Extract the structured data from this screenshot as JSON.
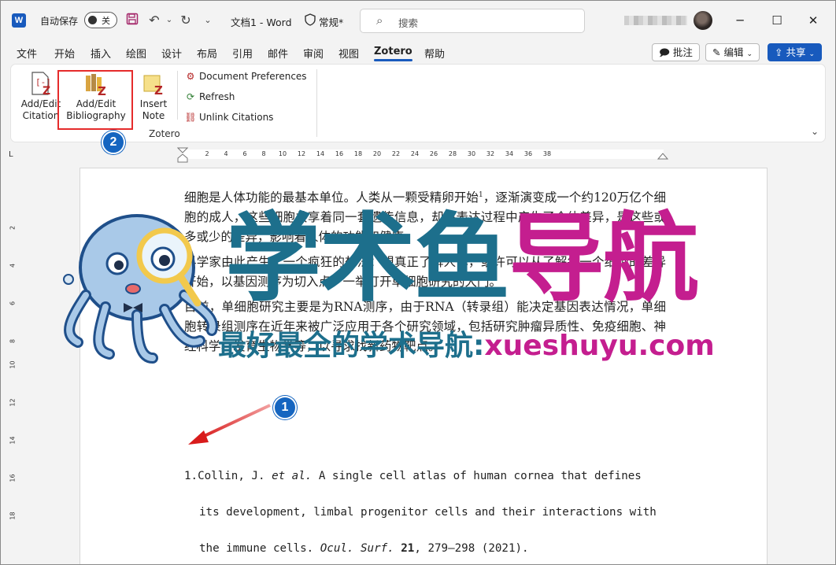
{
  "titlebar": {
    "autosave_label": "自动保存",
    "autosave_state": "关",
    "doc_title": "文档1 - Word",
    "sensitivity": "常规*",
    "search_placeholder": "搜索"
  },
  "menu": {
    "tabs": [
      "文件",
      "开始",
      "插入",
      "绘图",
      "设计",
      "布局",
      "引用",
      "邮件",
      "审阅",
      "视图",
      "Zotero",
      "帮助"
    ],
    "active_tab": "Zotero",
    "comment_label": "批注",
    "edit_label": "编辑",
    "share_label": "共享"
  },
  "ribbon": {
    "add_edit_citation": [
      "Add/Edit",
      "Citation"
    ],
    "add_edit_bibliography": [
      "Add/Edit",
      "Bibliography"
    ],
    "insert_note": [
      "Insert",
      "Note"
    ],
    "doc_prefs": "Document Preferences",
    "refresh": "Refresh",
    "unlink": "Unlink Citations",
    "group_label": "Zotero"
  },
  "annotations": {
    "badge_1": "1",
    "badge_2": "2"
  },
  "ruler": {
    "h_ticks": [
      "2",
      "4",
      "6",
      "8",
      "10",
      "12",
      "14",
      "16",
      "18",
      "20",
      "22",
      "24",
      "26",
      "28",
      "30",
      "32",
      "34",
      "36",
      "38"
    ],
    "v_ticks": [
      "2",
      "4",
      "6",
      "8",
      "10",
      "12",
      "14",
      "16",
      "18"
    ]
  },
  "document": {
    "para1_before_sup": "细胞是人体功能的最基本单位。人类从一颗受精卵开始",
    "para1_sup": "1",
    "para1_after_sup": "，逐渐演变成一个约120万亿个细胞的成人，这些细胞共享着同一套遗传信息，却在表达过程中产生了个体差异，是这些或多或少的差异，影响着人体的功能和健康。",
    "para2": "科学家由此产生了一个疯狂的想法：想真正了解人体，或许可以从了解每一个细胞的差异开始，以基因测序为切入点，一举打开单细胞研究的大门。",
    "para3": "目前，单细胞研究主要是为RNA测序，由于RNA（转录组）能决定基因表达情况，单细胞转录组测序在近年来被广泛应用于各个研究领域，包括研究肿瘤异质性、免疫细胞、神经科学、发育生物学等，以寻求找新药物靶点。",
    "ref_number": "1.",
    "ref_line1_a": "Collin, J. ",
    "ref_line1_i": "et al.",
    "ref_line1_b": " A single cell atlas of human cornea that defines",
    "ref_line2": "its development, limbal progenitor cells and their interactions with",
    "ref_line3_a": "the immune cells. ",
    "ref_line3_i": "Ocul. Surf.",
    "ref_line3_sp": " ",
    "ref_line3_b": "21",
    "ref_line3_c": ", 279–298 (2021)."
  },
  "watermark": {
    "title_part1": "学术鱼",
    "title_part2": "导航",
    "subtitle_part1": "最好最全的学术导航:",
    "subtitle_part2": "xueshuyu.com"
  },
  "colors": {
    "word_blue": "#185abd",
    "highlight_red": "#e52b2b",
    "badge_blue": "#1565c0",
    "watermark_teal": "#1d6f8c",
    "watermark_magenta": "#c41e8f"
  }
}
